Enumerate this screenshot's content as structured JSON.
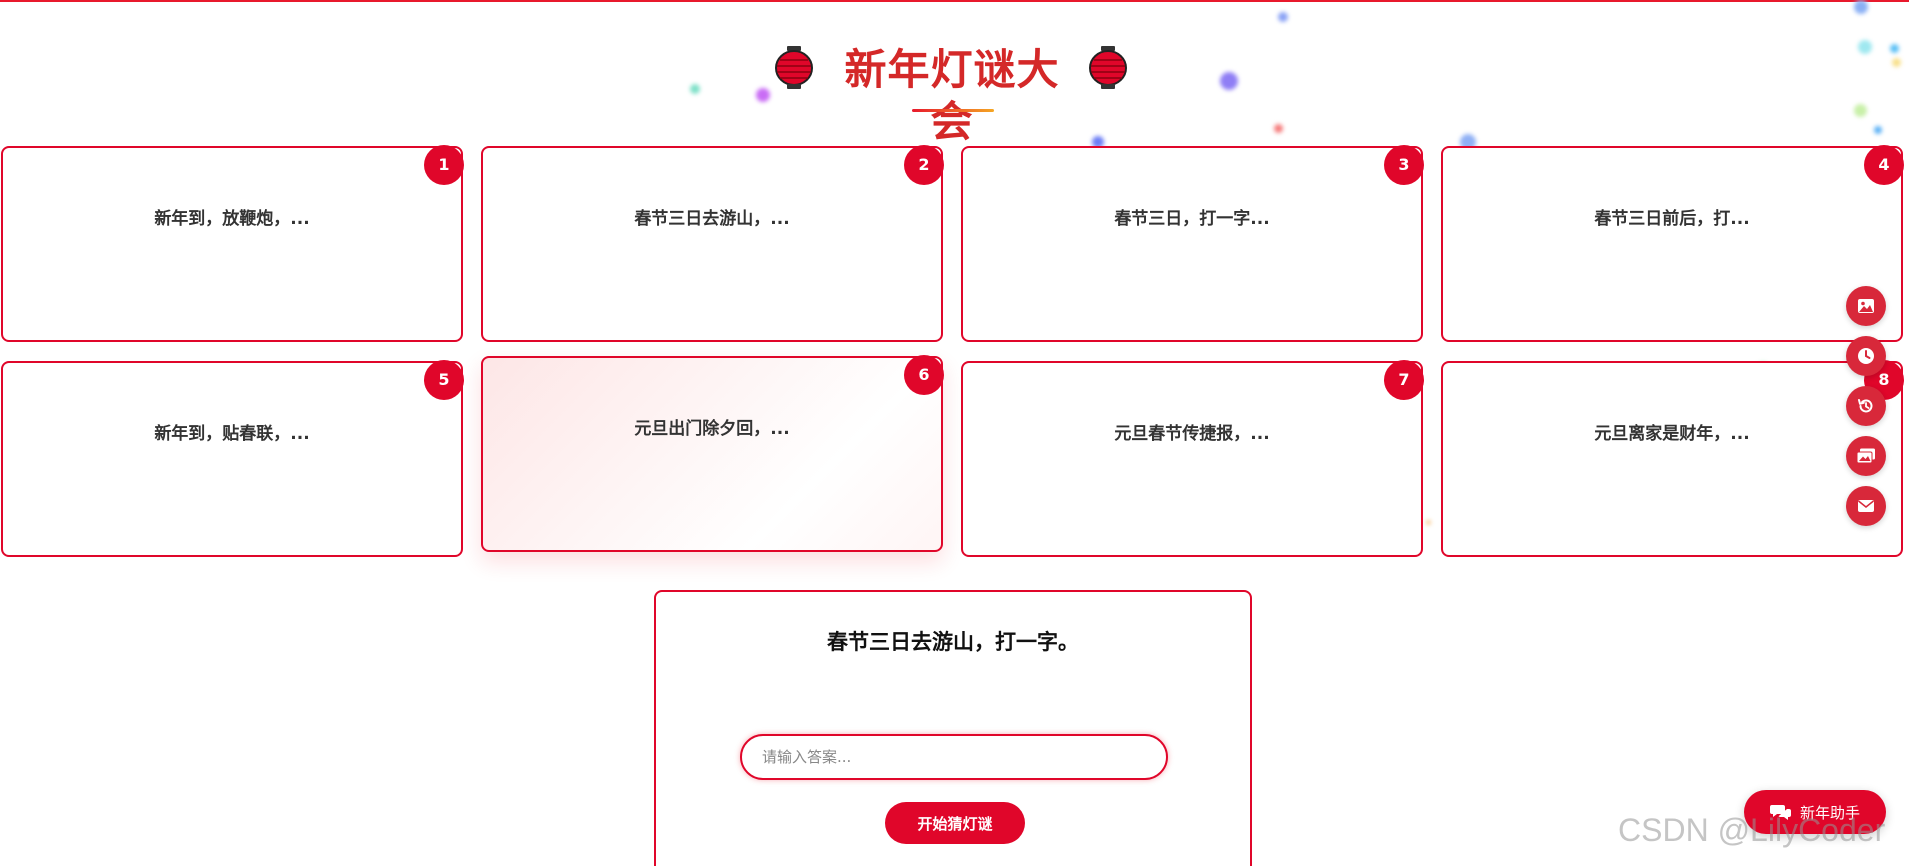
{
  "header": {
    "title": "新年灯谜大会"
  },
  "riddles": [
    {
      "number": "1",
      "preview": "新年到，放鞭炮，..."
    },
    {
      "number": "2",
      "preview": "春节三日去游山，..."
    },
    {
      "number": "3",
      "preview": "春节三日，打一字..."
    },
    {
      "number": "4",
      "preview": "春节三日前后，打..."
    },
    {
      "number": "5",
      "preview": "新年到，贴春联，..."
    },
    {
      "number": "6",
      "preview": "元旦出门除夕回，..."
    },
    {
      "number": "7",
      "preview": "元旦春节传捷报，..."
    },
    {
      "number": "8",
      "preview": "元旦离家是财年，..."
    }
  ],
  "question_panel": {
    "question": "春节三日去游山，打一字。",
    "answer_placeholder": "请输入答案...",
    "answer_value": "",
    "start_button": "开始猜灯谜"
  },
  "toolbar": {
    "buttons": [
      {
        "icon": "image-icon"
      },
      {
        "icon": "clock-icon"
      },
      {
        "icon": "history-icon"
      },
      {
        "icon": "gallery-icon"
      },
      {
        "icon": "envelope-icon"
      }
    ]
  },
  "assistant": {
    "label": "新年助手",
    "icon": "chat-icon"
  },
  "watermark": "CSDN @LilyCoder",
  "colors": {
    "accent": "#e0062a",
    "title": "#d42828",
    "card_text": "#333333"
  }
}
